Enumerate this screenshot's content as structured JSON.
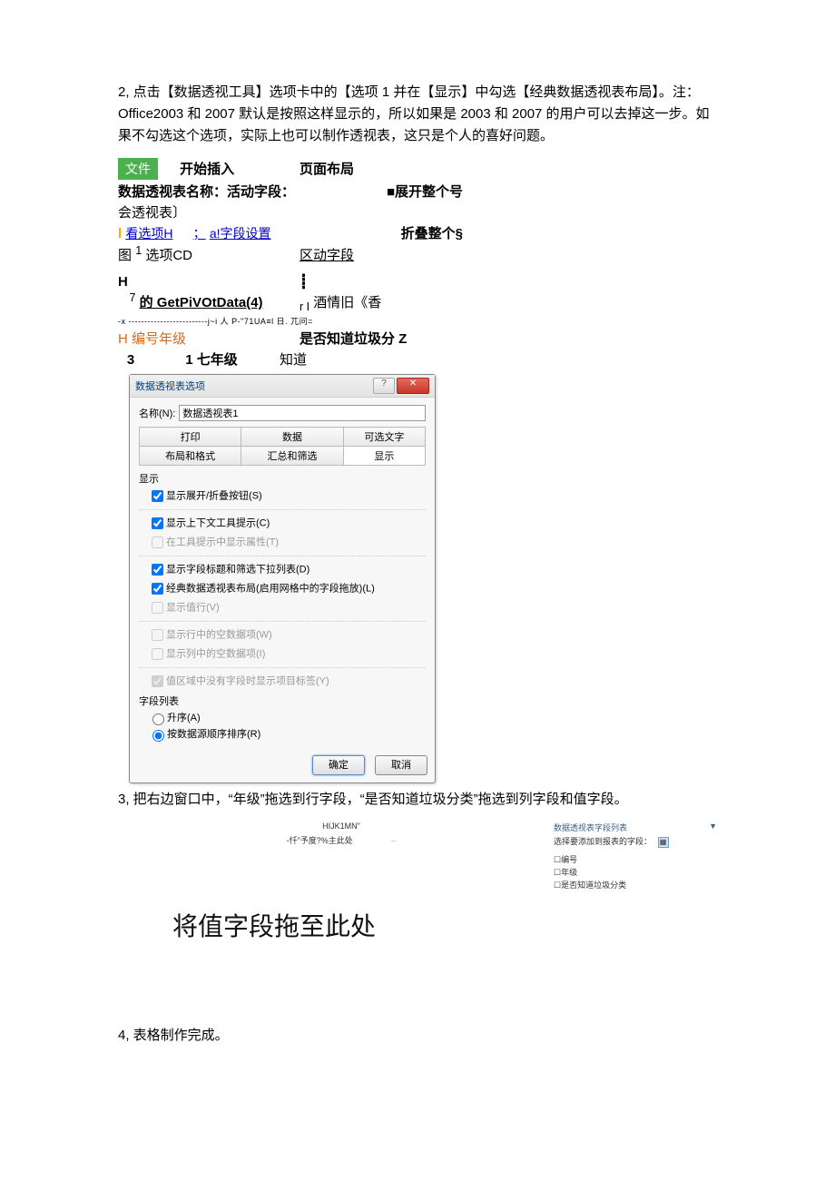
{
  "para2": "2, 点击【数据透视工具】选项卡中的【选项 1 并在【显示】中勾选【经典数据透视表布局】。注：Office2003 和 2007 默认是按照这样显示的，所以如果是 2003 和 2007 的用户可以去掉这一步。如果不勾选这个选项，实际上也可以制作透视表，这只是个人的喜好问题。",
  "ribbon": {
    "file": "文件",
    "startInsert": "开始插入",
    "pageLayout": "页面布局",
    "pivotName": "数据透视表名称：活动字段：",
    "expand": "■展开整个号",
    "huiPivot": "会透视表〕",
    "kanH": "看选项H",
    "fieldSetup": "a!字段设置",
    "collapse": "折叠整个§",
    "tu": "图",
    "one": "1",
    "optCD": "选项CD",
    "zoneField": "区动字段",
    "H": "H",
    "arrowDot": "┋",
    "seven": "7",
    "getpivot": "的 GetPiVOtData(4)",
    "rI": "r I",
    "wine": "酒情旧《香",
    "dashline": "-x -------------------------j~i 人 P-\"71UA≡l 日. 兀问=",
    "hNum": "H 编号年级",
    "knowTrash": "是否知道垃圾分 Z",
    "three": "3",
    "oneSeven": "1 七年级",
    "know": "知道"
  },
  "dialog": {
    "title": "数据透视表选项",
    "nameLabel": "名称(N):",
    "nameValue": "数据透视表1",
    "tabs": {
      "print": "打印",
      "data": "数据",
      "alttext": "可选文字",
      "layout": "布局和格式",
      "totals": "汇总和筛选",
      "display": "显示"
    },
    "sectionDisplay": "显示",
    "chkExpand": "显示展开/折叠按钮(S)",
    "chkContext": "显示上下文工具提示(C)",
    "chkAttrInTip": "在工具提示中显示属性(T)",
    "chkFieldTitles": "显示字段标题和筛选下拉列表(D)",
    "chkClassic": "经典数据透视表布局(启用网格中的字段拖放)(L)",
    "chkValueRow": "显示值行(V)",
    "chkEmptyRow": "显示行中的空数据项(W)",
    "chkEmptyCol": "显示列中的空数据项(I)",
    "chkNoFieldLabel": "值区域中没有字段时显示项目标签(Y)",
    "sectionFieldList": "字段列表",
    "radioAsc": "升序(A)",
    "radioSource": "按数据源顺序排序(R)",
    "ok": "确定",
    "cancel": "取消"
  },
  "para3": "3, 把右边窗口中，“年级”拖选到行字段，“是否知道垃圾分类”拖选到列字段和值字段。",
  "fieldlist": {
    "centerTop": "HIJK1MN\"",
    "centerSub": "-忏”予度?%主此处",
    "panelTitle": "数据透视表字段列表",
    "arrow": "▼",
    "pickLabel": "选择要添加到报表的字段：",
    "f1": "编号",
    "f2": "年级",
    "f3": "是否知道垃圾分类"
  },
  "dropzone": "将值字段拖至此处",
  "para4": "4, 表格制作完成。"
}
